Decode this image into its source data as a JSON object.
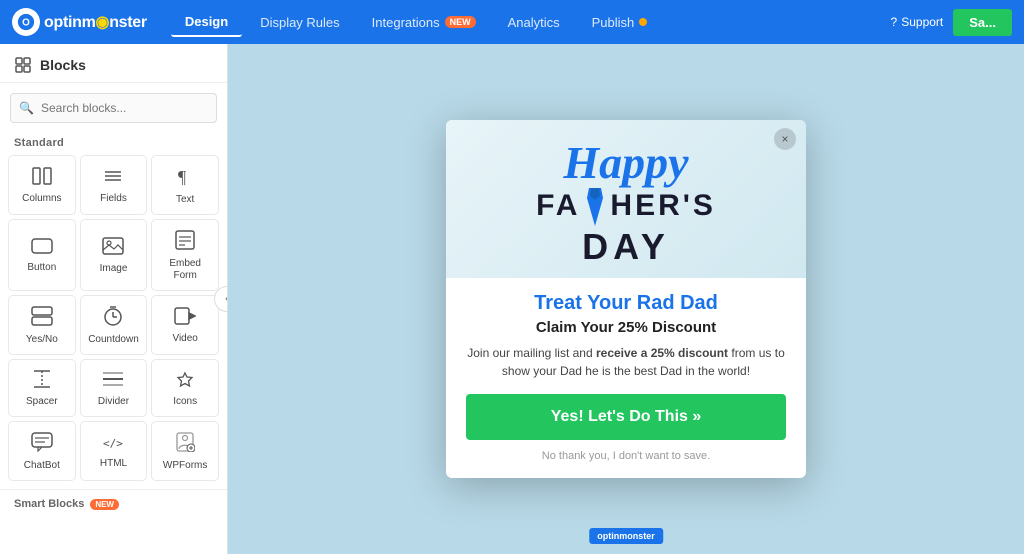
{
  "logo": {
    "text": "optinm nster",
    "icon": "🟢"
  },
  "nav": {
    "tabs": [
      {
        "label": "Design",
        "active": true,
        "badge": null
      },
      {
        "label": "Display Rules",
        "active": false,
        "badge": null
      },
      {
        "label": "Integrations",
        "active": false,
        "badge": "NEW"
      },
      {
        "label": "Analytics",
        "active": false,
        "badge": null
      },
      {
        "label": "Publish",
        "active": false,
        "badge": "dot"
      }
    ],
    "support_label": "⓪ Support",
    "save_label": "Sa..."
  },
  "sidebar": {
    "title": "Blocks",
    "search_placeholder": "Search blocks...",
    "section_standard": "Standard",
    "blocks": [
      {
        "id": "columns",
        "label": "Columns",
        "icon": "▦"
      },
      {
        "id": "fields",
        "label": "Fields",
        "icon": "☰"
      },
      {
        "id": "text",
        "label": "Text",
        "icon": "¶"
      },
      {
        "id": "button",
        "label": "Button",
        "icon": "⬚"
      },
      {
        "id": "image",
        "label": "Image",
        "icon": "🖼"
      },
      {
        "id": "embed-form",
        "label": "Embed Form",
        "icon": "📋"
      },
      {
        "id": "yes-no",
        "label": "Yes/No",
        "icon": "↕"
      },
      {
        "id": "countdown",
        "label": "Countdown",
        "icon": "⏰"
      },
      {
        "id": "video",
        "label": "Video",
        "icon": "🎬"
      },
      {
        "id": "spacer",
        "label": "Spacer",
        "icon": "↕"
      },
      {
        "id": "divider",
        "label": "Divider",
        "icon": "—"
      },
      {
        "id": "icons",
        "label": "Icons",
        "icon": "♡"
      },
      {
        "id": "chatbot",
        "label": "ChatBot",
        "icon": "💬"
      },
      {
        "id": "html",
        "label": "HTML",
        "icon": "</>"
      },
      {
        "id": "wpforms",
        "label": "WPForms",
        "icon": "🔒"
      }
    ],
    "section_smart": "Smart Blocks",
    "smart_badge": "NEW"
  },
  "popup": {
    "happy_text": "Happy",
    "fathers_day_line1": "FA",
    "fathers_day_line1b": "HER'S",
    "fathers_day_line2": "DAY",
    "promo_title": "Treat Your Rad Dad",
    "promo_subtitle": "Claim Your 25% Discount",
    "promo_desc_1": "Join our mailing list and ",
    "promo_desc_bold": "receive a 25% discount",
    "promo_desc_2": " from us to show your Dad he is the best Dad in the world!",
    "cta_label": "Yes! Let's Do This »",
    "decline_label": "No thank you, I don't want to save.",
    "brand_label": "optinmonster",
    "close_label": "×"
  }
}
